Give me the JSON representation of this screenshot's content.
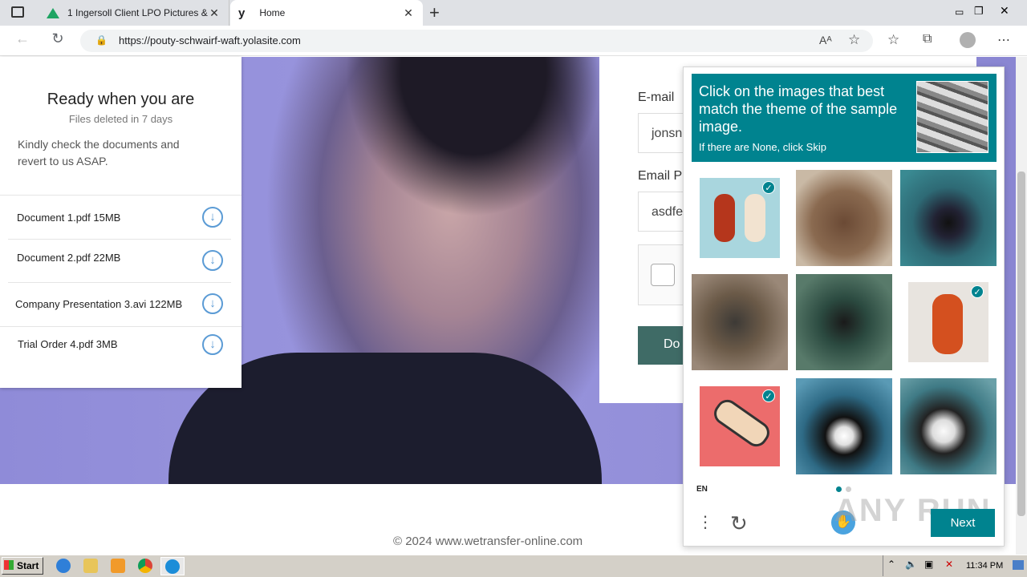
{
  "browser": {
    "tabs": [
      {
        "label": "1 Ingersoll Client LPO Pictures &",
        "icon": "google-drive-icon"
      },
      {
        "label": "Home",
        "icon": "yola-icon"
      }
    ],
    "url": "https://pouty-schwairf-waft.yolasite.com",
    "new_tab": "+"
  },
  "left_card": {
    "title": "Ready when you are",
    "subtitle": "Files deleted in 7 days",
    "message": "Kindly check the documents and revert to us ASAP.",
    "documents": [
      {
        "name": "Document 1.pdf 15MB"
      },
      {
        "name": "Document 2.pdf 22MB"
      },
      {
        "name": "Company Presentation 3.avi 122MB"
      },
      {
        "name": "Trial Order 4.pdf 3MB"
      }
    ]
  },
  "form": {
    "email_label": "E-mail",
    "email_value": "jonsn",
    "password_label": "Email P",
    "password_value": "asdfe",
    "button_label": "Do"
  },
  "footer": {
    "copyright": "© 2024 www.wetransfer-online.com"
  },
  "captcha": {
    "prompt": "Click on the images that best match the theme of the sample image.",
    "skip_hint": "If there are None, click Skip",
    "tiles": [
      {
        "name": "violins",
        "selected": true
      },
      {
        "name": "bear",
        "selected": false
      },
      {
        "name": "penguin-underwater",
        "selected": false
      },
      {
        "name": "bear-sunglasses",
        "selected": false
      },
      {
        "name": "diver",
        "selected": false
      },
      {
        "name": "violin",
        "selected": true
      },
      {
        "name": "violin-case",
        "selected": true
      },
      {
        "name": "penguin-bubbles",
        "selected": false
      },
      {
        "name": "penguin",
        "selected": false
      }
    ],
    "language": "EN",
    "next_label": "Next"
  },
  "watermark": "ANY RUN",
  "taskbar": {
    "start_label": "Start",
    "clock": "11:34 PM"
  },
  "colors": {
    "captcha_accent": "#00838f",
    "form_button": "#3f6b66"
  }
}
